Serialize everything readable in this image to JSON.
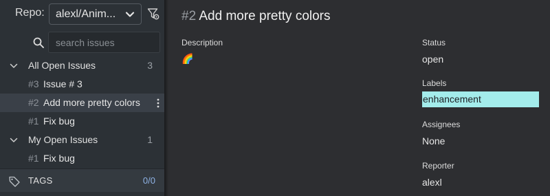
{
  "sidebar": {
    "repo_label": "Repo:",
    "repo_value": "alexl/Anim...",
    "search_placeholder": "search issues",
    "groups": [
      {
        "label": "All Open Issues",
        "count": "3",
        "issues": [
          {
            "number": "#3",
            "title": "Issue # 3"
          },
          {
            "number": "#2",
            "title": "Add more pretty colors",
            "selected": true
          },
          {
            "number": "#1",
            "title": "Fix bug"
          }
        ]
      },
      {
        "label": "My Open Issues",
        "count": "1",
        "issues": [
          {
            "number": "#1",
            "title": "Fix bug"
          }
        ]
      }
    ],
    "tags_label": "TAGS",
    "tags_count": "0/0"
  },
  "issue": {
    "number": "#2",
    "title": "Add more pretty colors",
    "description_label": "Description",
    "description_value": "🌈",
    "status_label": "Status",
    "status_value": "open",
    "labels_label": "Labels",
    "labels": [
      {
        "name": "enhancement",
        "color": "#a3eceb"
      }
    ],
    "assignees_label": "Assignees",
    "assignees_value": "None",
    "reporter_label": "Reporter",
    "reporter_value": "alexl"
  },
  "colors": {
    "sidebar_bg": "#2c3136",
    "main_bg": "#2d2e31",
    "selected_row": "#3a4048",
    "tags_count": "#8fb3e6"
  }
}
